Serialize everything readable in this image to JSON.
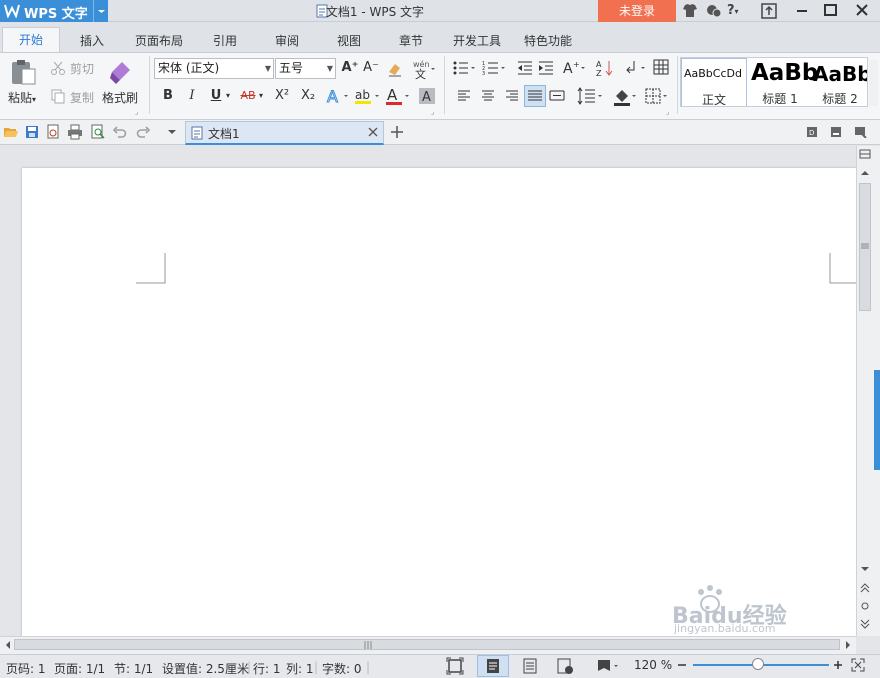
{
  "titlebar": {
    "app_name": "WPS 文字",
    "doc_title": "文档1 - WPS 文字",
    "login_label": "未登录",
    "help_label": "?"
  },
  "tabs": [
    "开始",
    "插入",
    "页面布局",
    "引用",
    "审阅",
    "视图",
    "章节",
    "开发工具",
    "特色功能"
  ],
  "ribbon": {
    "clipboard": {
      "paste": "粘贴",
      "cut": "剪切",
      "copy": "复制",
      "format_painter": "格式刷"
    },
    "font": {
      "font_name": "宋体 (正文)",
      "font_size": "五号",
      "bold": "B",
      "italic": "I",
      "underline": "U",
      "strike": "AB",
      "superscript": "X²",
      "subscript": "X₂",
      "font_color": "A",
      "shading": "A",
      "grow": "A⁺",
      "shrink": "A⁻"
    },
    "styles": [
      {
        "preview": "AaBbCcDd",
        "name": "正文"
      },
      {
        "preview": "AaBb",
        "name": "标题 1"
      },
      {
        "preview": "AaBb",
        "name": "标题 2"
      }
    ]
  },
  "doc_tab": {
    "label": "文档1"
  },
  "status": {
    "page_num": "页码: 1",
    "pages": "页面: 1/1",
    "section": "节: 1/1",
    "setting": "设置值: 2.5厘米",
    "row": "行: 1",
    "col": "列: 1",
    "words": "字数: 0",
    "zoom": "120 %"
  },
  "zoom": {
    "level_fraction": 0.48
  },
  "watermark": {
    "brand": "Baidu经验",
    "url": "jingyan.baidu.com"
  },
  "colors": {
    "accent": "#3b8fd8",
    "login": "#f07050",
    "home_tab_text": "#2d7ad6"
  }
}
